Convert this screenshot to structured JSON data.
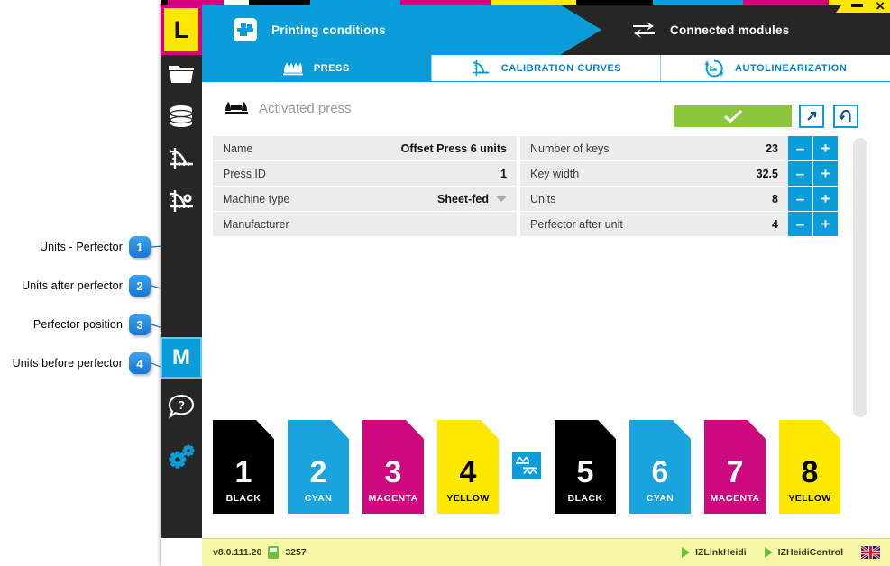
{
  "window": {
    "logo": "L",
    "minimize_label": "minimize",
    "close_label": "×",
    "color_strip": [
      "#000000",
      "#d4007f",
      "#ffffff",
      "#000000",
      "#0b9dd9",
      "#d4007f",
      "#ffe800",
      "#000000",
      "#0b9dd9",
      "#d4007f",
      "#ffe800"
    ]
  },
  "header": {
    "primary": {
      "title": "Printing conditions",
      "icon": "press-sheet-icon"
    },
    "secondary": {
      "title": "Connected modules",
      "icon": "sync-arrows-icon"
    }
  },
  "tabs": [
    {
      "label": "PRESS",
      "icon": "press-units-icon",
      "active": true
    },
    {
      "label": "CALIBRATION CURVES",
      "icon": "curve-icon",
      "active": false
    },
    {
      "label": "AUTOLINEARIZATION",
      "icon": "autolinearization-icon",
      "active": false
    }
  ],
  "sidebar": {
    "items": [
      {
        "name": "folder-icon",
        "label": "Jobs"
      },
      {
        "name": "database-icon",
        "label": "Database"
      },
      {
        "name": "curve-icon",
        "label": "Curves"
      },
      {
        "name": "curve-settings-icon",
        "label": "Curve settings"
      },
      {
        "name": "measure-button",
        "label": "M"
      },
      {
        "name": "help-icon",
        "label": "Help"
      },
      {
        "name": "settings-gears-icon",
        "label": "Settings"
      }
    ]
  },
  "main": {
    "section_title": "Activated press",
    "section_icon": "press-icon",
    "actions": {
      "confirm_label": "✔",
      "confirm_color": "#8cc63f",
      "edit_label": "edit-icon",
      "undo_label": "undo-icon"
    },
    "left_table": [
      {
        "key": "Name",
        "value": "Offset Press 6 units",
        "type": "text"
      },
      {
        "key": "Press ID",
        "value": "1",
        "type": "text"
      },
      {
        "key": "Machine type",
        "value": "Sheet-fed",
        "type": "dropdown"
      },
      {
        "key": "Manufacturer",
        "value": "",
        "type": "text"
      }
    ],
    "right_table": [
      {
        "key": "Number of keys",
        "value": "23",
        "type": "stepper"
      },
      {
        "key": "Key width",
        "value": "32.5",
        "type": "stepper"
      },
      {
        "key": "Units",
        "value": "8",
        "type": "stepper"
      },
      {
        "key": "Perfector after unit",
        "value": "4",
        "type": "stepper"
      }
    ],
    "stepper": {
      "minus": "–",
      "plus": "+"
    }
  },
  "press_units": [
    {
      "number": "1",
      "name": "BLACK",
      "bg": "#000000",
      "fg": "#ffffff"
    },
    {
      "number": "2",
      "name": "CYAN",
      "bg": "#19a4dd",
      "fg": "#ffffff"
    },
    {
      "number": "3",
      "name": "MAGENTA",
      "bg": "#cc0a7d",
      "fg": "#ffffff"
    },
    {
      "number": "4",
      "name": "YELLOW",
      "bg": "#ffe800",
      "fg": "#000000"
    },
    {
      "number": "5",
      "name": "BLACK",
      "bg": "#000000",
      "fg": "#ffffff"
    },
    {
      "number": "6",
      "name": "CYAN",
      "bg": "#19a4dd",
      "fg": "#ffffff"
    },
    {
      "number": "7",
      "name": "MAGENTA",
      "bg": "#cc0a7d",
      "fg": "#ffffff"
    },
    {
      "number": "8",
      "name": "YELLOW",
      "bg": "#ffe800",
      "fg": "#000000"
    }
  ],
  "perfector": {
    "icon": "perfector-icon",
    "after_unit": 4
  },
  "footer": {
    "version": "v8.0.111.20",
    "dongle_icon": "dongle-icon",
    "number": "3257",
    "links": [
      {
        "label": "IZLinkHeidi",
        "icon": "play-icon"
      },
      {
        "label": "IZHeidiControl",
        "icon": "play-icon"
      }
    ],
    "language_flag": "uk-flag-icon"
  },
  "callouts": [
    {
      "number": "1",
      "label": "Units - Perfector"
    },
    {
      "number": "2",
      "label": "Units after perfector"
    },
    {
      "number": "3",
      "label": "Perfector position"
    },
    {
      "number": "4",
      "label": "Units before perfector"
    }
  ],
  "colors": {
    "accent": "#0b9dd9",
    "dark": "#262626",
    "green": "#8cc63f",
    "yellow": "#ffe800",
    "magenta": "#d4007f"
  }
}
